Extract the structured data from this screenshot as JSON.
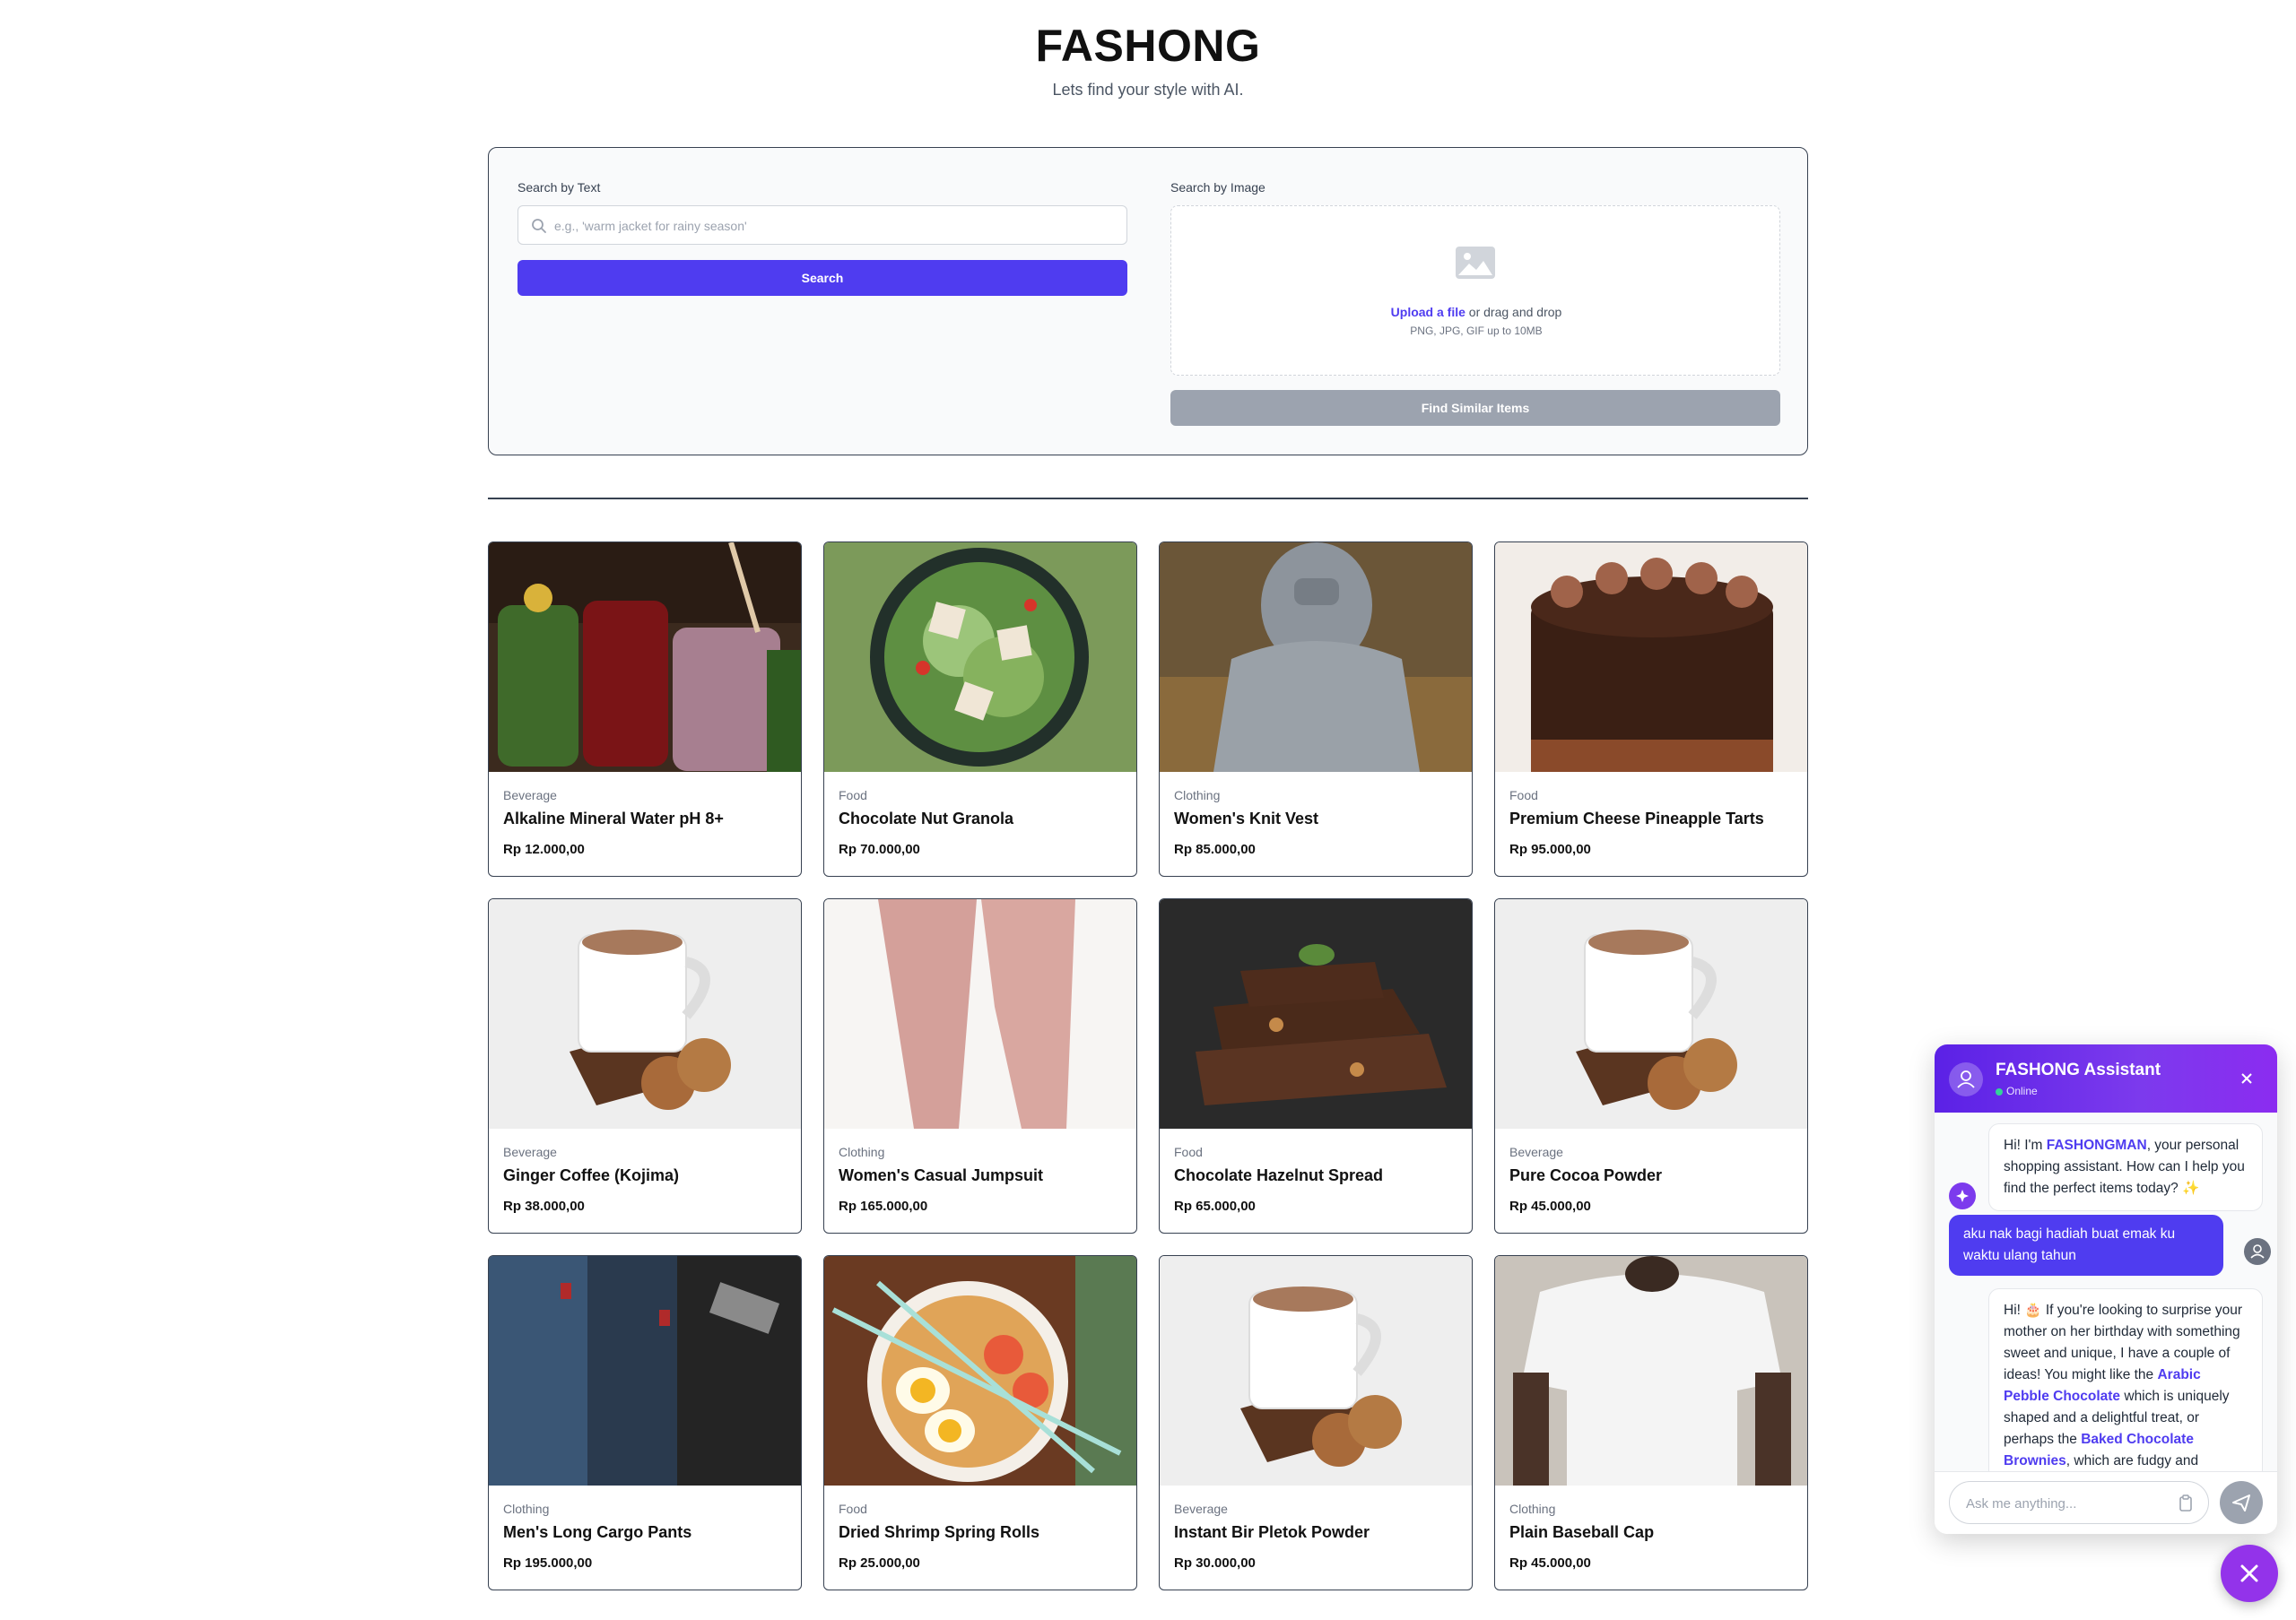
{
  "header": {
    "brand": "FASHONG",
    "tagline": "Lets find your style with AI."
  },
  "search": {
    "text_label": "Search by Text",
    "text_placeholder": "e.g., 'warm jacket for rainy season'",
    "search_button": "Search",
    "image_label": "Search by Image",
    "upload_link": "Upload a file",
    "upload_rest": " or drag and drop",
    "upload_hint": "PNG, JPG, GIF up to 10MB",
    "similar_button": "Find Similar Items"
  },
  "products": [
    {
      "category": "Beverage",
      "name": "Alkaline Mineral Water pH 8+",
      "price": "Rp 12.000,00",
      "image": "smoothie-jars"
    },
    {
      "category": "Food",
      "name": "Chocolate Nut Granola",
      "price": "Rp 70.000,00",
      "image": "salad-bowl"
    },
    {
      "category": "Clothing",
      "name": "Women's Knit Vest",
      "price": "Rp 85.000,00",
      "image": "grey-hoodie"
    },
    {
      "category": "Food",
      "name": "Premium Cheese Pineapple Tarts",
      "price": "Rp 95.000,00",
      "image": "chocolate-cake"
    },
    {
      "category": "Beverage",
      "name": "Ginger Coffee (Kojima)",
      "price": "Rp 38.000,00",
      "image": "coffee-cookies"
    },
    {
      "category": "Clothing",
      "name": "Women's Casual Jumpsuit",
      "price": "Rp 165.000,00",
      "image": "pink-pants"
    },
    {
      "category": "Food",
      "name": "Chocolate Hazelnut Spread",
      "price": "Rp 65.000,00",
      "image": "chocolate-bars"
    },
    {
      "category": "Beverage",
      "name": "Pure Cocoa Powder",
      "price": "Rp 45.000,00",
      "image": "coffee-cookies"
    },
    {
      "category": "Clothing",
      "name": "Men's Long Cargo Pants",
      "price": "Rp 195.000,00",
      "image": "jeans-stack"
    },
    {
      "category": "Food",
      "name": "Dried Shrimp Spring Rolls",
      "price": "Rp 25.000,00",
      "image": "ramen-bowl"
    },
    {
      "category": "Beverage",
      "name": "Instant Bir Pletok Powder",
      "price": "Rp 30.000,00",
      "image": "coffee-cookies"
    },
    {
      "category": "Clothing",
      "name": "Plain Baseball Cap",
      "price": "Rp 45.000,00",
      "image": "white-tshirt"
    }
  ],
  "chat": {
    "title": "FASHONG Assistant",
    "status": "Online",
    "bot_msg_1": {
      "pre": "Hi! I'm ",
      "link": "FASHONGMAN",
      "post": ", your personal shopping assistant. How can I help you find the perfect items today? ✨"
    },
    "user_msg": "aku nak bagi hadiah buat emak ku waktu ulang tahun",
    "bot_msg_2": {
      "pre": "Hi! 🎂 If you're looking to surprise your mother on her birthday with something sweet and unique, I have a couple of ideas! You might like the ",
      "link1": "Arabic Pebble Chocolate",
      "mid": " which is uniquely shaped and a delightful treat, or perhaps the ",
      "link2": "Baked Chocolate Brownies",
      "post": ", which are fudgy and"
    },
    "input_placeholder": "Ask me anything..."
  }
}
